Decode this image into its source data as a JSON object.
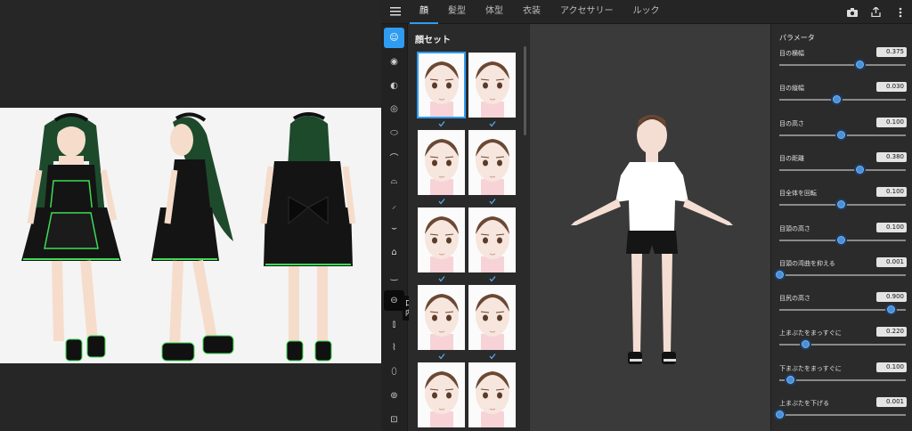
{
  "tabs": [
    {
      "label": "顔",
      "active": true
    },
    {
      "label": "髪型",
      "active": false
    },
    {
      "label": "体型",
      "active": false
    },
    {
      "label": "衣装",
      "active": false
    },
    {
      "label": "アクセサリー",
      "active": false
    },
    {
      "label": "ルック",
      "active": false
    }
  ],
  "top_actions": [
    "camera-icon",
    "share-icon",
    "more-vert-icon"
  ],
  "rail": {
    "tooltip": "口内",
    "items": [
      "face-set-icon",
      "eye-icon",
      "eye-highlight-icon",
      "eyeball-icon",
      "eye-shape-icon",
      "eyebrow-icon",
      "eyelash-icon",
      "eyeliner-icon",
      "eyelid-icon",
      "nose-icon",
      "mouth-icon",
      "mouth-inner-icon",
      "teeth-icon",
      "ear-icon",
      "face-outline-icon",
      "head-icon",
      "face-icon"
    ]
  },
  "presets": {
    "title": "顔セット"
  },
  "params": {
    "title": "パラメータ",
    "items": [
      {
        "label": "目の横幅",
        "value": "0.375",
        "fraction": 0.66
      },
      {
        "label": "目の縦幅",
        "value": "0.030",
        "fraction": 0.47
      },
      {
        "label": "目の高さ",
        "value": "0.100",
        "fraction": 0.51
      },
      {
        "label": "目の距離",
        "value": "0.380",
        "fraction": 0.66
      },
      {
        "label": "目全体を回転",
        "value": "0.100",
        "fraction": 0.51
      },
      {
        "label": "目頭の高さ",
        "value": "0.100",
        "fraction": 0.51
      },
      {
        "label": "目頭の湾曲を抑える",
        "value": "0.001",
        "fraction": 0.0
      },
      {
        "label": "目尻の高さ",
        "value": "0.900",
        "fraction": 0.92
      },
      {
        "label": "上まぶたをまっすぐに",
        "value": "0.220",
        "fraction": 0.21
      },
      {
        "label": "下まぶたをまっすぐに",
        "value": "0.100",
        "fraction": 0.09
      },
      {
        "label": "上まぶたを下げる",
        "value": "0.001",
        "fraction": 0.0
      }
    ]
  },
  "colors": {
    "accent": "#2f9cf2",
    "dress": "#141414",
    "trim": "#3ddc55",
    "hair": "#1e4a2c",
    "skin": "#f6dccb"
  }
}
